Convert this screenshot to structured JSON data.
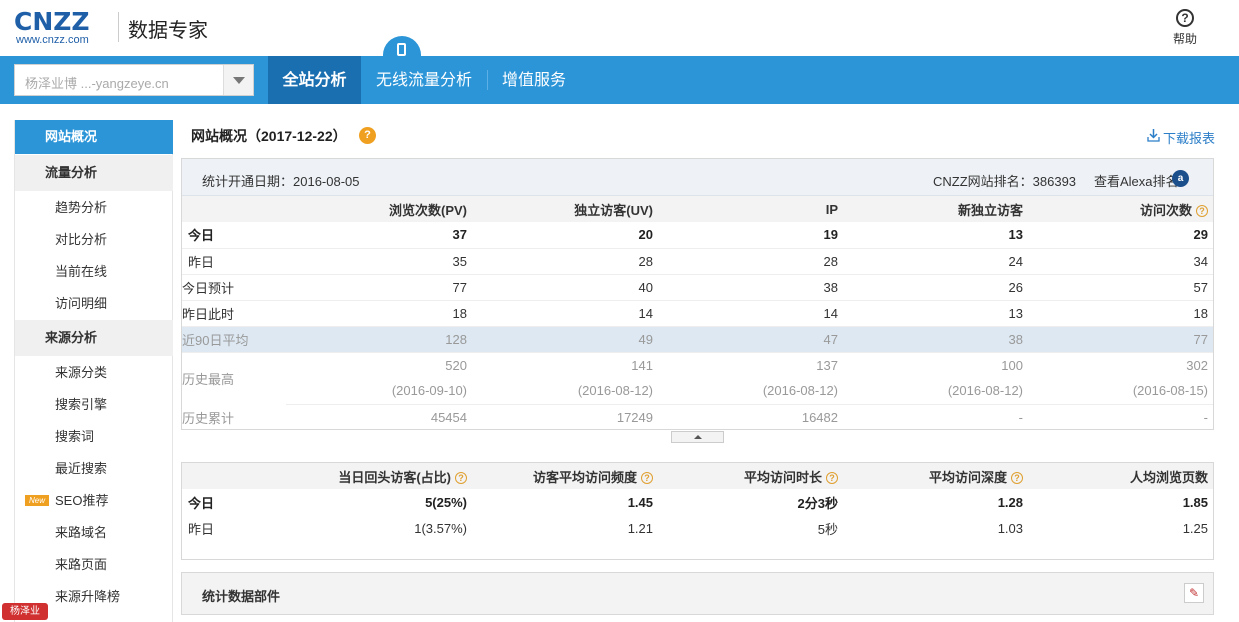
{
  "header": {
    "logo_main": "CNZZ",
    "logo_sub": "www.cnzz.com",
    "product_name": "数据专家",
    "help_label": "帮助"
  },
  "navbar": {
    "site_selector_value": "杨泽业博 ...-yangzeye.cn",
    "tabs": [
      {
        "label": "全站分析",
        "active": true
      },
      {
        "label": "无线流量分析",
        "active": false
      },
      {
        "label": "增值服务",
        "active": false
      }
    ]
  },
  "sidebar": {
    "overview": "网站概况",
    "traffic_head": "流量分析",
    "traffic_items": [
      "趋势分析",
      "对比分析",
      "当前在线",
      "访问明细"
    ],
    "source_head": "来源分析",
    "source_items": [
      "来源分类",
      "搜索引擎",
      "搜索词",
      "最近搜索",
      "SEO推荐",
      "来路域名",
      "来路页面",
      "来源升降榜"
    ],
    "new_badge": "New"
  },
  "main": {
    "title": "网站概况（2017-12-22）",
    "download_label": "下载报表",
    "info": {
      "start_date": "统计开通日期：2016-08-05",
      "rank": "CNZZ网站排名：386393",
      "alexa_link": "查看Alexa排名",
      "alexa_badge": "a"
    },
    "table1": {
      "headers": [
        "浏览次数(PV)",
        "独立访客(UV)",
        "IP",
        "新独立访客",
        "访问次数"
      ],
      "rows": [
        {
          "label": "今日",
          "values": [
            "37",
            "20",
            "19",
            "13",
            "29"
          ]
        },
        {
          "label": "昨日",
          "values": [
            "35",
            "28",
            "28",
            "24",
            "34"
          ]
        },
        {
          "label": "今日预计",
          "values": [
            "77",
            "40",
            "38",
            "26",
            "57"
          ]
        },
        {
          "label": "昨日此时",
          "values": [
            "18",
            "14",
            "14",
            "13",
            "18"
          ]
        },
        {
          "label": "近90日平均",
          "values": [
            "128",
            "49",
            "47",
            "38",
            "77"
          ]
        },
        {
          "label": "历史最高",
          "values": [
            "520",
            "141",
            "137",
            "100",
            "302"
          ]
        },
        {
          "label": "",
          "values": [
            "(2016-09-10)",
            "(2016-08-12)",
            "(2016-08-12)",
            "(2016-08-12)",
            "(2016-08-15)"
          ]
        },
        {
          "label": "历史累计",
          "values": [
            "45454",
            "17249",
            "16482",
            "-",
            "-"
          ]
        }
      ]
    },
    "table2": {
      "headers": [
        "当日回头访客(占比)",
        "访客平均访问频度",
        "平均访问时长",
        "平均访问深度",
        "人均浏览页数"
      ],
      "rows": [
        {
          "label": "今日",
          "values": [
            "5(25%)",
            "1.45",
            "2分3秒",
            "1.28",
            "1.85"
          ]
        },
        {
          "label": "昨日",
          "values": [
            "1(3.57%)",
            "1.21",
            "5秒",
            "1.03",
            "1.25"
          ]
        }
      ]
    },
    "widgets_title": "统计数据部件",
    "help_mark": "?"
  },
  "watermark": "杨泽业"
}
